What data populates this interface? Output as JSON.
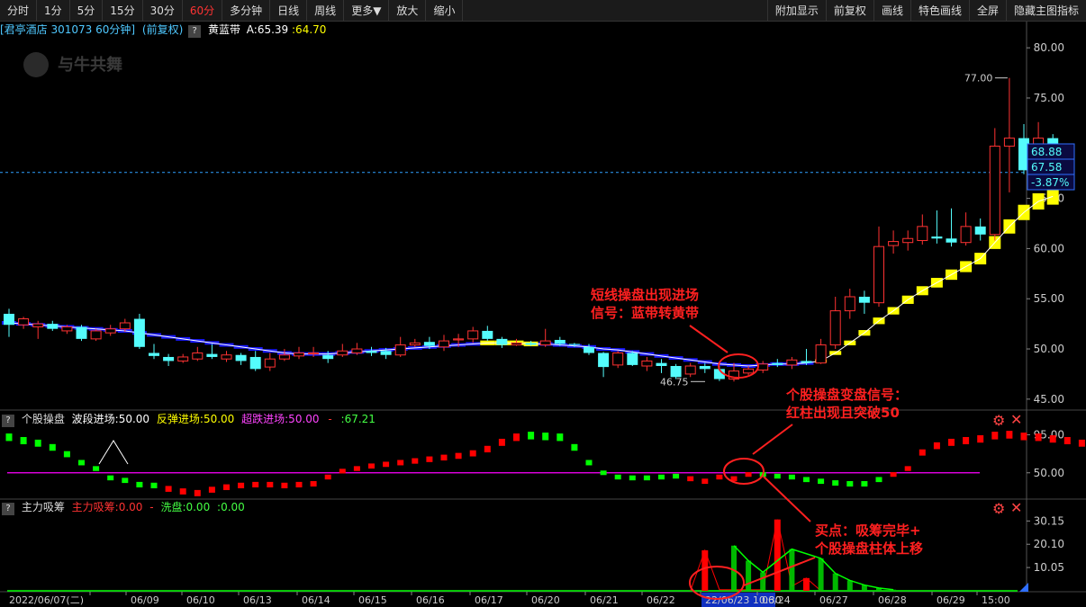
{
  "toolbar": {
    "left": [
      "分时",
      "1分",
      "5分",
      "15分",
      "30分",
      "60分",
      "多分钟",
      "日线",
      "周线",
      "更多▼",
      "放大",
      "缩小"
    ],
    "active": "60分",
    "right": [
      "附加显示",
      "前复权",
      "画线",
      "特色画线",
      "全屏",
      "隐藏主图指标"
    ]
  },
  "main_info": {
    "stock": "[君亭酒店 301073 60分钟]",
    "adjust": "(前复权)",
    "indicator": "黄蓝带",
    "a_label": "A:65.39",
    "b_label": ":64.70"
  },
  "watermark": "与牛共舞",
  "ind1_info": {
    "name": "个股操盘",
    "l1": "波段进场:50.00",
    "l2": "反弹进场:50.00",
    "l3": "超跌进场:50.00",
    "l4": "-",
    "l5": ":67.21"
  },
  "ind2_info": {
    "name": "主力吸筹",
    "l1": "主力吸筹:0.00",
    "l2": "-",
    "l3": "洗盘:0.00",
    "l4": ":0.00"
  },
  "annotations": {
    "a1_line1": "短线操盘出现进场",
    "a1_line2": "信号：蓝带转黄带",
    "a2_line1": "个股操盘变盘信号：",
    "a2_line2": "红柱出现且突破50",
    "a3_line1": "买点：吸筹完毕+",
    "a3_line2": "个股操盘柱体上移"
  },
  "price_labels": {
    "high": "77.00",
    "low": "46.75"
  },
  "right_tags": {
    "price1": "68.88",
    "price2": "67.58",
    "change": "-3.87%"
  },
  "colors": {
    "up": "#ff3232",
    "down": "#54fcfc",
    "yellow": "#ffff00",
    "blue": "#1818ff",
    "magenta": "#ff00ff",
    "green": "#00ff00",
    "red": "#ff0000"
  },
  "chart_data": [
    {
      "type": "candlestick",
      "yticks": [
        45,
        50,
        55,
        60,
        65,
        70,
        75,
        80
      ],
      "ytick_labels": [
        "45.00",
        "50.00",
        "55.00",
        "60.00",
        "65.00",
        "70.00",
        "75.00",
        "80.00"
      ],
      "ylim": [
        44,
        81
      ],
      "x_labels": [
        "2022/06/07(二)",
        "06/09",
        "06/10",
        "06/13",
        "06/14",
        "06/15",
        "06/16",
        "06/17",
        "06/20",
        "06/21",
        "06/22",
        "22/06/23 10:30",
        "06/24",
        "06/27",
        "06/28",
        "06/29",
        "15:00"
      ],
      "candles": [
        [
          53.5,
          52.4,
          54.0,
          51.2
        ],
        [
          52.4,
          53.0,
          53.2,
          52.0
        ],
        [
          52.2,
          52.5,
          52.8,
          51.0
        ],
        [
          52.5,
          52.0,
          52.8,
          51.8
        ],
        [
          51.8,
          52.2,
          52.4,
          51.5
        ],
        [
          52.2,
          51.0,
          52.4,
          50.8
        ],
        [
          51.0,
          51.8,
          52.0,
          50.8
        ],
        [
          51.6,
          52.0,
          52.4,
          51.3
        ],
        [
          52.0,
          52.6,
          53.0,
          51.7
        ],
        [
          53.0,
          50.2,
          53.5,
          50.0
        ],
        [
          49.6,
          49.3,
          50.5,
          49.0
        ],
        [
          49.2,
          48.8,
          49.5,
          48.3
        ],
        [
          48.8,
          49.2,
          49.5,
          48.6
        ],
        [
          49.0,
          49.6,
          50.2,
          48.8
        ],
        [
          49.5,
          49.2,
          50.5,
          49.0
        ],
        [
          49.0,
          49.4,
          49.8,
          48.7
        ],
        [
          49.4,
          48.8,
          49.6,
          48.4
        ],
        [
          49.2,
          48.0,
          49.8,
          47.8
        ],
        [
          48.2,
          49.0,
          49.6,
          47.8
        ],
        [
          49.0,
          49.4,
          50.0,
          48.8
        ],
        [
          49.3,
          49.6,
          50.2,
          49.0
        ],
        [
          49.5,
          49.6,
          50.2,
          49.2
        ],
        [
          49.4,
          49.0,
          49.8,
          48.6
        ],
        [
          49.4,
          49.8,
          50.5,
          49.2
        ],
        [
          49.6,
          50.0,
          50.6,
          49.4
        ],
        [
          49.8,
          49.6,
          50.2,
          49.3
        ],
        [
          49.8,
          49.4,
          50.1,
          49.0
        ],
        [
          49.4,
          50.4,
          51.2,
          49.2
        ],
        [
          50.4,
          50.6,
          51.0,
          50.2
        ],
        [
          50.7,
          50.3,
          51.2,
          50.0
        ],
        [
          50.2,
          50.8,
          51.4,
          49.8
        ],
        [
          50.9,
          51.0,
          51.5,
          50.2
        ],
        [
          51.0,
          51.8,
          52.2,
          50.6
        ],
        [
          51.8,
          51.0,
          52.3,
          50.8
        ],
        [
          51.0,
          50.4,
          51.2,
          50.1
        ],
        [
          50.4,
          50.6,
          51.0,
          50.3
        ],
        [
          50.6,
          50.4,
          50.8,
          50.3
        ],
        [
          50.4,
          50.8,
          52.0,
          50.2
        ],
        [
          50.9,
          50.5,
          51.2,
          50.3
        ],
        [
          50.5,
          50.4,
          50.6,
          50.2
        ],
        [
          50.2,
          49.6,
          50.5,
          49.4
        ],
        [
          49.6,
          48.2,
          49.7,
          47.2
        ],
        [
          48.4,
          49.6,
          49.8,
          48.1
        ],
        [
          49.6,
          48.4,
          49.8,
          48.3
        ],
        [
          48.3,
          48.8,
          49.2,
          47.8
        ],
        [
          48.6,
          48.3,
          49.0,
          47.6
        ],
        [
          48.3,
          47.2,
          48.5,
          47.0
        ],
        [
          47.5,
          48.3,
          48.6,
          47.2
        ],
        [
          48.3,
          48.0,
          48.6,
          47.6
        ],
        [
          48.0,
          47.0,
          48.3,
          46.8
        ],
        [
          47.0,
          47.8,
          48.6,
          46.75
        ],
        [
          47.6,
          48.0,
          48.3,
          47.4
        ],
        [
          47.9,
          48.5,
          48.8,
          47.6
        ],
        [
          48.6,
          48.4,
          49.0,
          48.2
        ],
        [
          48.4,
          48.9,
          49.2,
          48.0
        ],
        [
          48.8,
          48.6,
          50.0,
          48.4
        ],
        [
          48.6,
          50.4,
          51.0,
          48.5
        ],
        [
          50.4,
          53.8,
          55.2,
          50.0
        ],
        [
          53.8,
          55.2,
          56.0,
          53.0
        ],
        [
          55.2,
          54.6,
          55.8,
          53.5
        ],
        [
          54.6,
          60.2,
          62.2,
          54.2
        ],
        [
          60.3,
          60.7,
          61.8,
          59.5
        ],
        [
          60.6,
          61.0,
          61.8,
          59.8
        ],
        [
          60.8,
          62.2,
          63.4,
          60.4
        ],
        [
          61.2,
          61.0,
          63.8,
          60.5
        ],
        [
          61.0,
          60.6,
          64.0,
          60.2
        ],
        [
          60.6,
          62.2,
          63.6,
          60.3
        ],
        [
          62.2,
          61.4,
          63.0,
          60.8
        ],
        [
          61.4,
          70.2,
          72.0,
          60.8
        ],
        [
          70.2,
          71.0,
          77.0,
          65.6
        ],
        [
          71.0,
          67.8,
          72.4,
          67.4
        ],
        [
          67.8,
          71.0,
          72.6,
          67.4
        ],
        [
          71.0,
          68.2,
          71.4,
          67.6
        ]
      ],
      "band": [
        52.6,
        52.5,
        52.4,
        52.3,
        52.2,
        52.1,
        52.0,
        51.9,
        51.8,
        51.6,
        51.4,
        51.2,
        51.0,
        50.8,
        50.6,
        50.4,
        50.2,
        50.0,
        49.8,
        49.6,
        49.5,
        49.5,
        49.5,
        49.6,
        49.7,
        49.8,
        49.9,
        50.0,
        50.1,
        50.2,
        50.3,
        50.4,
        50.5,
        50.6,
        50.6,
        50.6,
        50.5,
        50.5,
        50.4,
        50.3,
        50.2,
        50.0,
        49.9,
        49.7,
        49.5,
        49.3,
        49.1,
        48.9,
        48.7,
        48.5,
        48.4,
        48.3,
        48.4,
        48.5,
        48.5,
        48.6,
        48.8,
        49.6,
        50.6,
        51.6,
        52.8,
        53.8,
        54.9,
        55.8,
        56.6,
        57.4,
        58.2,
        59.0,
        60.6,
        62.2,
        63.6,
        64.7,
        65.2
      ],
      "band_colors": "BBBBBBBBBBBBBBBBBBBBBBBBBBBBBBBBBYYYYBBBBBBBBBBBBBBBBBBBYYYYYYYYYYYYYYYYYY"
    },
    {
      "type": "dot-bar",
      "yticks": [
        50,
        95
      ],
      "ytick_labels": [
        "50.00",
        "95.00"
      ],
      "ylim": [
        20,
        105
      ],
      "reference_line": 50,
      "values": [
        92,
        88,
        85,
        80,
        72,
        62,
        55,
        44,
        41,
        36,
        35,
        31,
        28,
        26,
        30,
        33,
        35,
        36,
        36,
        35,
        36,
        37,
        45,
        52,
        55,
        58,
        60,
        62,
        64,
        66,
        68,
        70,
        73,
        78,
        86,
        92,
        94,
        93,
        92,
        80,
        62,
        50,
        45,
        44,
        44,
        45,
        46,
        43,
        40,
        45,
        43,
        48,
        48,
        46,
        45,
        42,
        40,
        38,
        37,
        37,
        42,
        48,
        55,
        74,
        82,
        86,
        88,
        90,
        94,
        95,
        93,
        92,
        90,
        88,
        85,
        80,
        72,
        62
      ],
      "colors": "GGGGGGGGGGGRRRRRRRRRRRRRRRRRRRRRRRRRGGGGGGGGGGGRRRRRGGGGGGGGGRRRRRRRRRRRRRRRRGGGG"
    },
    {
      "type": "bar-line",
      "yticks": [
        10.05,
        20.1,
        30.15
      ],
      "ytick_labels": [
        "10.05",
        "20.10",
        "30.15"
      ],
      "ylim": [
        0,
        33
      ],
      "red_bars": [
        [
          48,
          17.5
        ],
        [
          53,
          30.8
        ],
        [
          55,
          5.5
        ]
      ],
      "green": [
        [
          50,
          19.5
        ],
        [
          51,
          13.0
        ],
        [
          52,
          8.0
        ],
        [
          54,
          18.0
        ],
        [
          56,
          14.0
        ],
        [
          57,
          7.5
        ],
        [
          58,
          4.5
        ],
        [
          59,
          2.5
        ],
        [
          60,
          1.2
        ],
        [
          61,
          0.5
        ]
      ]
    }
  ]
}
